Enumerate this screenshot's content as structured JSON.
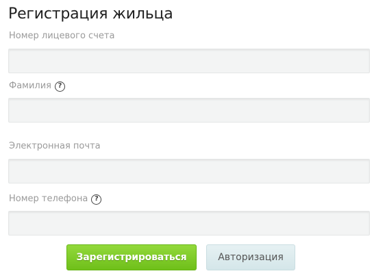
{
  "form": {
    "title": "Регистрация жильца",
    "fields": [
      {
        "label": "Номер лицевого счета",
        "value": "",
        "placeholder": "",
        "help": false
      },
      {
        "label": "Фамилия",
        "value": "",
        "placeholder": "",
        "help": true
      },
      {
        "label": "Электронная почта",
        "value": "",
        "placeholder": "",
        "help": false
      },
      {
        "label": "Номер телефона",
        "value": "",
        "placeholder": "",
        "help": true
      }
    ],
    "help_icon": "question-mark",
    "help_glyph": "?",
    "buttons": {
      "register_label": "Зарегистрироваться",
      "login_label": "Авторизация"
    }
  },
  "colors": {
    "register_button": "#7cc828",
    "login_button": "#dcebee",
    "field_background": "#f3f4f4",
    "label_text": "#9a9a9a"
  }
}
